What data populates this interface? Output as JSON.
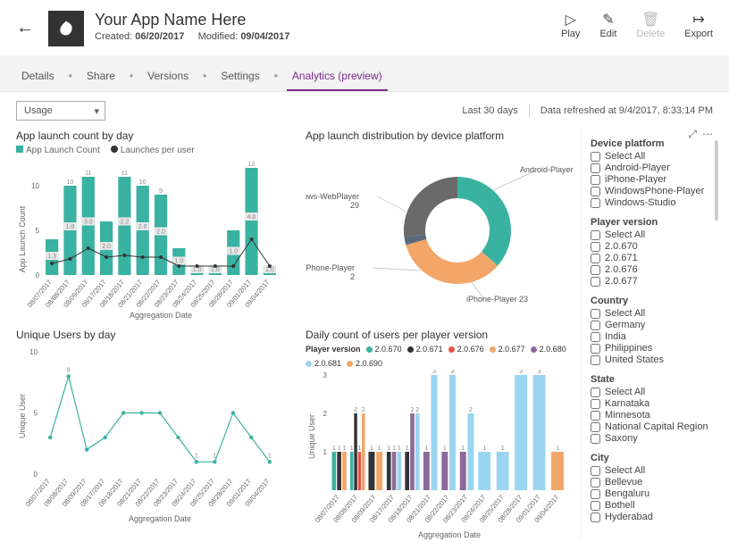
{
  "header": {
    "app_name": "Your App Name Here",
    "created_label": "Created:",
    "created_date": "06/20/2017",
    "modified_label": "Modified:",
    "modified_date": "09/04/2017",
    "actions": {
      "play": "Play",
      "edit": "Edit",
      "delete": "Delete",
      "export": "Export"
    }
  },
  "tabs": {
    "details": "Details",
    "share": "Share",
    "versions": "Versions",
    "settings": "Settings",
    "analytics": "Analytics (preview)"
  },
  "toolbar": {
    "dropdown_value": "Usage",
    "range": "Last 30 days",
    "refreshed": "Data refreshed at 9/4/2017, 8:33:14 PM"
  },
  "filters": {
    "device_platform": {
      "title": "Device platform",
      "options": [
        "Select All",
        "Android-Player",
        "iPhone-Player",
        "WindowsPhone-Player",
        "Windows-Studio"
      ]
    },
    "player_version": {
      "title": "Player version",
      "options": [
        "Select All",
        "2.0.670",
        "2.0.671",
        "2.0.676",
        "2.0.677"
      ]
    },
    "country": {
      "title": "Country",
      "options": [
        "Select All",
        "Germany",
        "India",
        "Philippines",
        "United States"
      ]
    },
    "state": {
      "title": "State",
      "options": [
        "Select All",
        "Karnataka",
        "Minnesota",
        "National Capital Region",
        "Saxony"
      ]
    },
    "city": {
      "title": "City",
      "options": [
        "Select All",
        "Bellevue",
        "Bengaluru",
        "Bothell",
        "Hyderabad"
      ]
    }
  },
  "chart_data": [
    {
      "id": "bar_combo",
      "type": "bar+line",
      "title": "App launch count by day",
      "legend": [
        "App Launch Count",
        "Launches per user"
      ],
      "xlabel": "Aggregation Date",
      "ylabel": "App Launch Count",
      "ylim": [
        0,
        12
      ],
      "categories": [
        "08/07/2017",
        "08/08/2017",
        "08/09/2017",
        "08/17/2017",
        "08/18/2017",
        "08/21/2017",
        "08/22/2017",
        "08/23/2017",
        "08/24/2017",
        "08/25/2017",
        "08/28/2017",
        "09/01/2017",
        "09/04/2017"
      ],
      "bar_values": [
        4,
        10,
        11,
        6,
        11,
        10,
        9,
        3,
        1,
        1,
        5,
        12,
        1
      ],
      "top_labels": [
        "",
        "10",
        "11",
        "",
        "11",
        "10",
        "9",
        "",
        "",
        "",
        "",
        "12",
        ""
      ],
      "mid_labels": [
        "1.3",
        "1.8",
        "3.0",
        "2.0",
        "2.2",
        "2.0",
        "2.0",
        "1.0",
        "1.0",
        "1.0",
        "1.0",
        "4.0",
        "1.0"
      ],
      "line_values": [
        1.3,
        1.8,
        3.0,
        2.0,
        2.2,
        2.0,
        2.0,
        1.0,
        1.0,
        1.0,
        1.0,
        4.0,
        1.0
      ]
    },
    {
      "id": "donut",
      "type": "donut",
      "title": "App launch distribution by device platform",
      "slices": [
        {
          "label": "Android-Player",
          "value": 31,
          "color": "#3ab2a2"
        },
        {
          "label": "Windows-WebPlayer",
          "value": 29,
          "color": "#f2a66a"
        },
        {
          "label": "WindowsPhone-Player",
          "value": 2,
          "color": "#5a6a7a"
        },
        {
          "label": "iPhone-Player",
          "value": 23,
          "color": "#6a6a6a"
        }
      ]
    },
    {
      "id": "line_users",
      "type": "line",
      "title": "Unique Users by day",
      "xlabel": "Aggregation Date",
      "ylabel": "Unique User",
      "ylim": [
        0,
        10
      ],
      "categories": [
        "08/07/2017",
        "08/08/2017",
        "08/09/2017",
        "08/17/2017",
        "08/18/2017",
        "08/21/2017",
        "08/22/2017",
        "08/23/2017",
        "08/24/2017",
        "08/25/2017",
        "08/28/2017",
        "09/01/2017",
        "09/04/2017"
      ],
      "values": [
        3,
        8,
        2,
        3,
        5,
        5,
        5,
        3,
        1,
        1,
        5,
        3,
        1
      ],
      "point_labels": [
        "",
        "8",
        "",
        "",
        "",
        "",
        "",
        "",
        "1",
        "1",
        "",
        "",
        "1"
      ]
    },
    {
      "id": "stacked",
      "type": "stacked-bar",
      "title": "Daily count of users per player version",
      "legend_title": "Player version",
      "xlabel": "Aggregation Date",
      "ylabel": "Unique User",
      "ylim": [
        0,
        3
      ],
      "categories": [
        "08/07/2017",
        "08/08/2017",
        "08/09/2017",
        "08/17/2017",
        "08/18/2017",
        "08/21/2017",
        "08/22/2017",
        "08/23/2017",
        "08/24/2017",
        "08/25/2017",
        "08/28/2017",
        "09/01/2017",
        "09/04/2017"
      ],
      "series": [
        {
          "name": "2.0.670",
          "color": "#3ab2a2",
          "values": [
            1,
            1,
            0,
            0,
            0,
            0,
            0,
            0,
            0,
            0,
            0,
            0,
            0
          ]
        },
        {
          "name": "2.0.671",
          "color": "#333333",
          "values": [
            1,
            2,
            1,
            1,
            1,
            0,
            0,
            0,
            0,
            0,
            0,
            0,
            0
          ]
        },
        {
          "name": "2.0.676",
          "color": "#e8534a",
          "values": [
            0,
            1,
            0,
            0,
            0,
            0,
            0,
            0,
            0,
            0,
            0,
            0,
            0
          ]
        },
        {
          "name": "2.0.677",
          "color": "#f2a66a",
          "values": [
            1,
            2,
            1,
            0,
            0,
            0,
            0,
            0,
            0,
            0,
            0,
            0,
            0
          ]
        },
        {
          "name": "2.0.680",
          "color": "#8a6a9a",
          "values": [
            0,
            0,
            0,
            1,
            2,
            1,
            1,
            1,
            0,
            0,
            0,
            0,
            0
          ]
        },
        {
          "name": "2.0.681",
          "color": "#9ad5f0",
          "values": [
            0,
            0,
            0,
            1,
            2,
            3,
            3,
            2,
            1,
            1,
            3,
            3,
            0
          ]
        },
        {
          "name": "2.0.690",
          "color": "#f2a66a",
          "values": [
            0,
            0,
            0,
            0,
            0,
            0,
            0,
            0,
            0,
            0,
            0,
            0,
            1
          ]
        }
      ]
    }
  ]
}
